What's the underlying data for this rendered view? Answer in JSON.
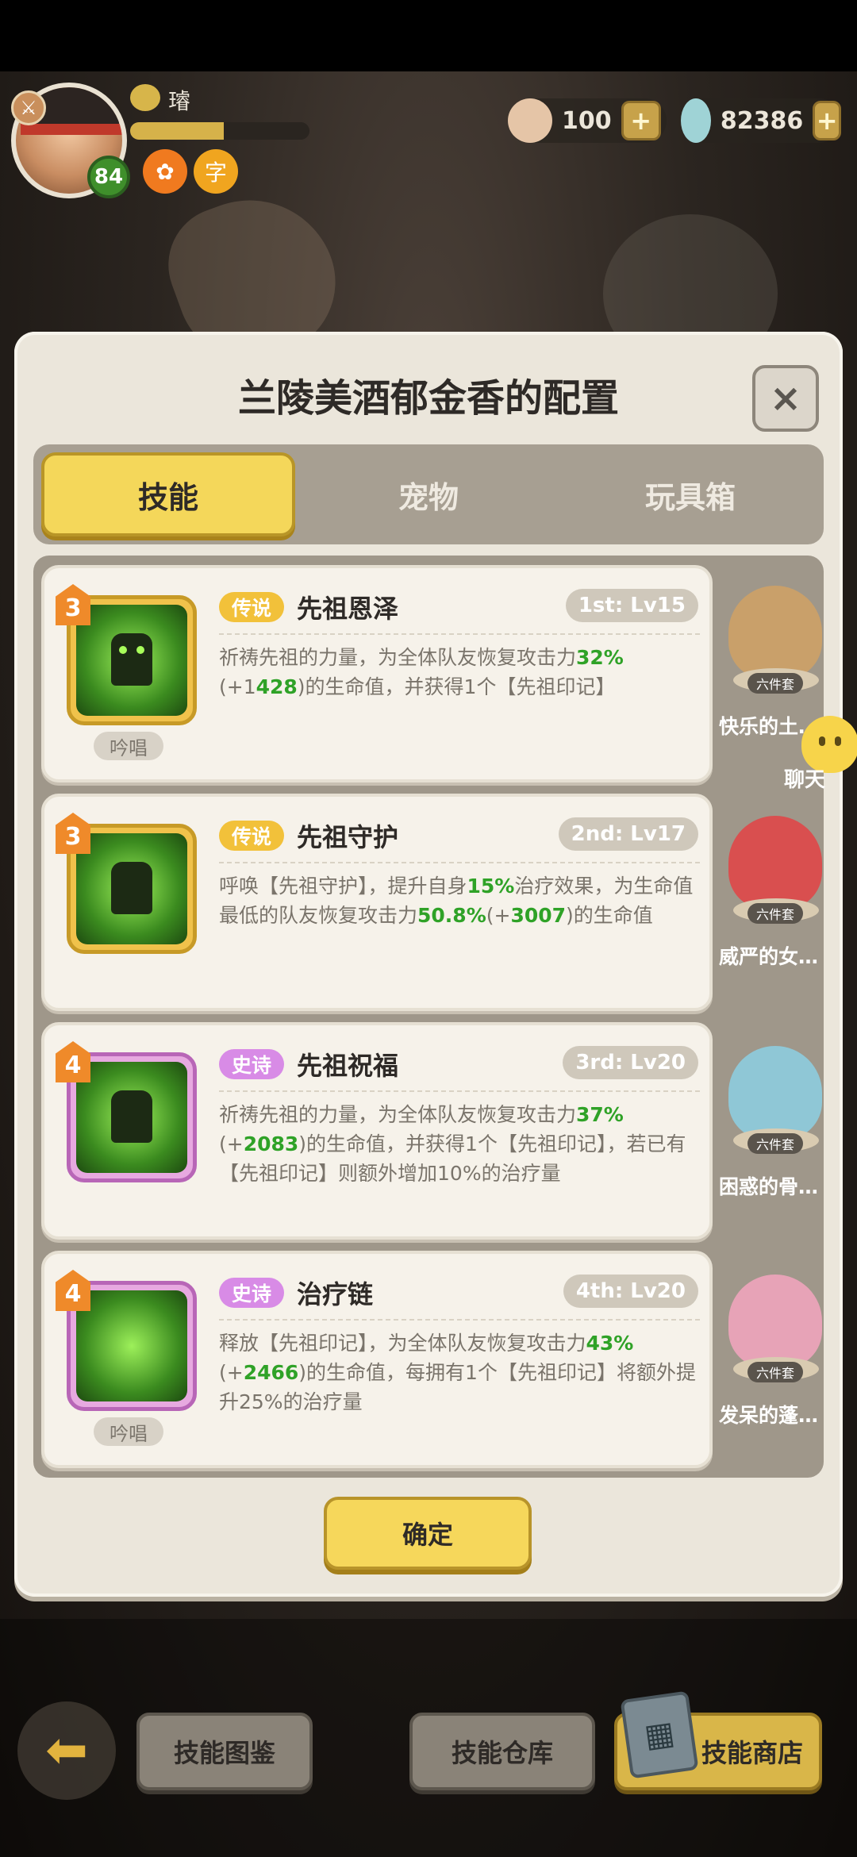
{
  "player": {
    "name": "璿",
    "level": "84",
    "exp_fraction": 0.52
  },
  "currencies": [
    {
      "name": "shell",
      "value": "100",
      "color": "#e5c5a7"
    },
    {
      "name": "stone",
      "value": "82386",
      "color": "#9fd3d6"
    }
  ],
  "panel": {
    "title": "兰陵美酒郁金香的配置",
    "close": "×",
    "tabs": [
      "技能",
      "宠物",
      "玩具箱"
    ],
    "confirm": "确定"
  },
  "skills": [
    {
      "rank": "3",
      "rarity": "传说",
      "name": "先祖恩泽",
      "lv": "1st: Lv15",
      "desc": [
        "祈祷先祖的力量，为全体队友恢复攻击力",
        "32%",
        "(+1",
        "428",
        ")的生命值，并获得1个【先祖印记】"
      ],
      "chant": "吟唱"
    },
    {
      "rank": "3",
      "rarity": "传说",
      "name": "先祖守护",
      "lv": "2nd: Lv17",
      "desc": [
        "呼唤【先祖守护】，提升自身",
        "15%",
        "治疗效果，为生命值最低的队友恢复攻击力",
        "50.8%",
        "(+",
        "3007",
        ")的生命值"
      ],
      "chant": ""
    },
    {
      "rank": "4",
      "rarity": "史诗",
      "name": "先祖祝福",
      "lv": "3rd: Lv20",
      "desc": [
        "祈祷先祖的力量，为全体队友恢复攻击力",
        "37%",
        "(+",
        "2083",
        ")的生命值，并获得1个【先祖印记】，若已有【先祖印记】则额外增加10%的治疗量"
      ],
      "chant": ""
    },
    {
      "rank": "4",
      "rarity": "史诗",
      "name": "治疗链",
      "lv": "4th: Lv20",
      "desc": [
        "释放【先祖印记】，为全体队友恢复攻击力",
        "43%",
        "(+",
        "2466",
        ")的生命值，每拥有1个【先祖印记】将额外提升25%的治疗量"
      ],
      "chant": "吟唱"
    }
  ],
  "pets": [
    {
      "name": "快乐的土…",
      "set": "六件套",
      "color": "#c9a06a"
    },
    {
      "name": "威严的女…",
      "set": "六件套",
      "color": "#d94f4f"
    },
    {
      "name": "困惑的骨…",
      "set": "六件套",
      "color": "#8fc7d6"
    },
    {
      "name": "发呆的蓬…",
      "set": "六件套",
      "color": "#e7a3b7"
    }
  ],
  "chat": {
    "label": "聊天"
  },
  "bottom": {
    "back_icon": "back-arrow-icon",
    "codex": "技能图鉴",
    "storage": "技能仓库",
    "shop": "技能商店"
  }
}
